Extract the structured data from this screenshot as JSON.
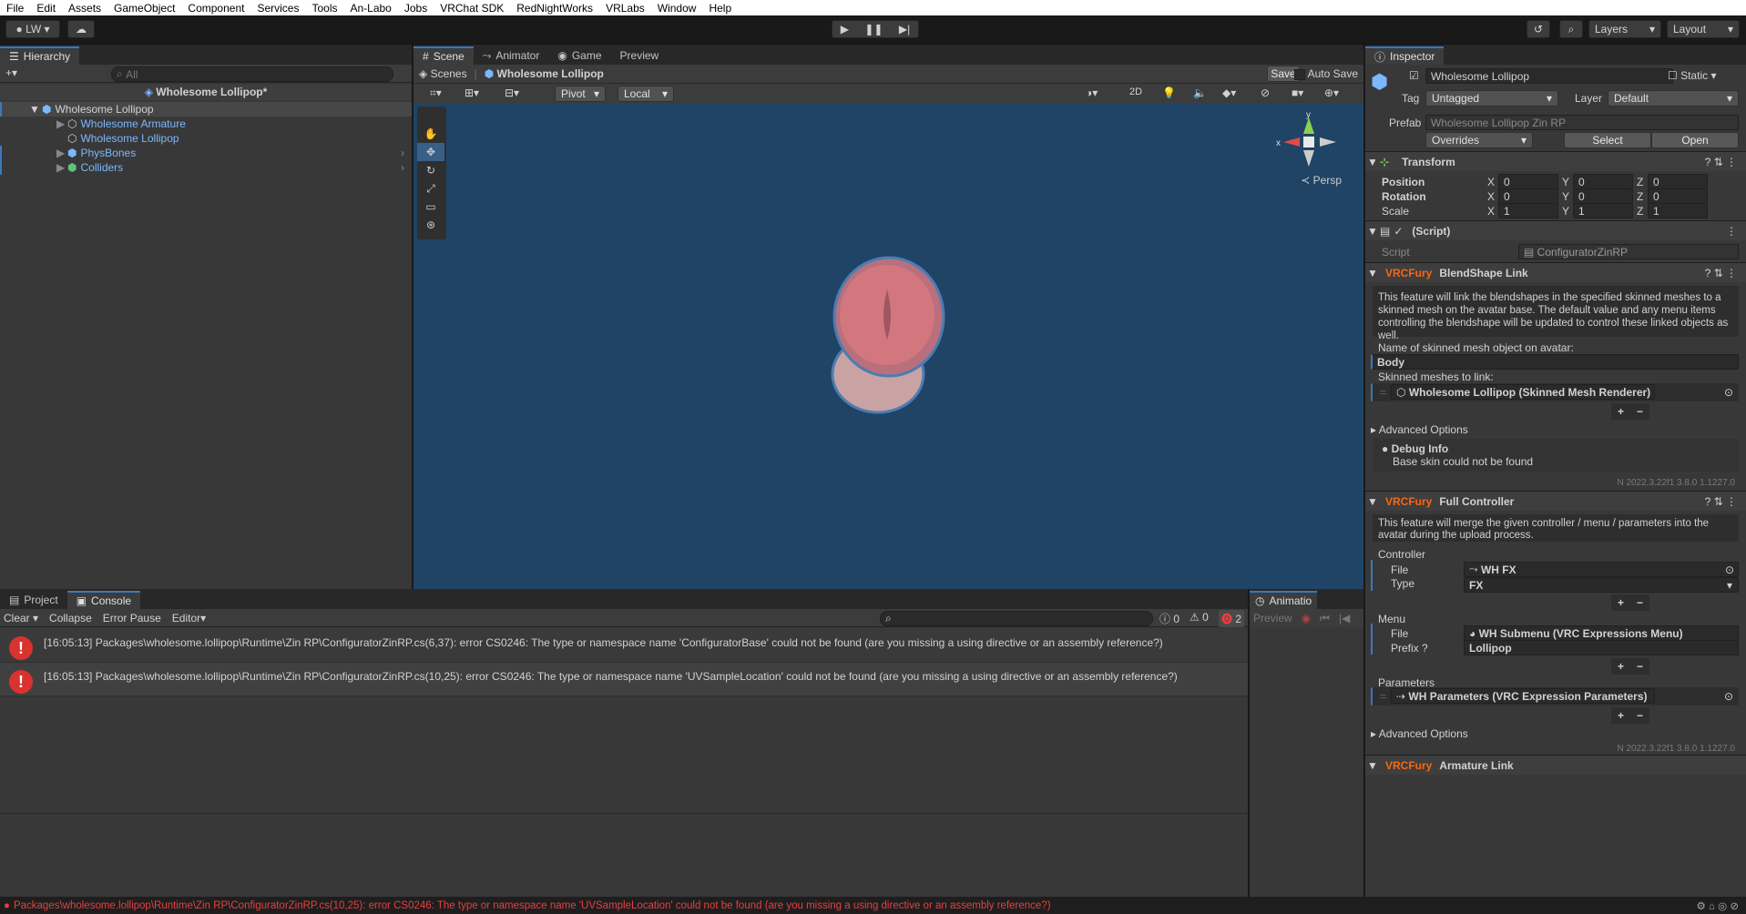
{
  "menu": [
    "File",
    "Edit",
    "Assets",
    "GameObject",
    "Component",
    "Services",
    "Tools",
    "An-Labo",
    "Jobs",
    "VRChat SDK",
    "RedNightWorks",
    "VRLabs",
    "Window",
    "Help"
  ],
  "toolbar": {
    "account": "LW",
    "layers": "Layers",
    "layout": "Layout"
  },
  "hierarchy": {
    "tab": "Hierarchy",
    "search_placeholder": "All",
    "scene": "Wholesome Lollipop*",
    "items": [
      {
        "label": "Wholesome Lollipop"
      },
      {
        "label": "Wholesome Armature"
      },
      {
        "label": "Wholesome Lollipop"
      },
      {
        "label": "PhysBones"
      },
      {
        "label": "Colliders"
      }
    ]
  },
  "scene": {
    "tabs": [
      "Scene",
      "Animator",
      "Game",
      "Preview"
    ],
    "breadcrumb": [
      "Scenes",
      "Wholesome Lollipop"
    ],
    "save": "Save",
    "autosave": "Auto Save",
    "pivot": "Pivot",
    "local": "Local",
    "mode2d": "2D",
    "persp": "Persp",
    "axis_x": "x",
    "axis_y": "y"
  },
  "console": {
    "tabs": [
      "Project",
      "Console"
    ],
    "buttons": [
      "Clear",
      "Collapse",
      "Error Pause",
      "Editor"
    ],
    "counts": {
      "log": "0",
      "warn": "0",
      "error": "2"
    },
    "entries": [
      "[16:05:13] Packages\\wholesome.lollipop\\Runtime\\Zin RP\\ConfiguratorZinRP.cs(6,37): error CS0246: The type or namespace name 'ConfiguratorBase' could not be found (are you missing a using directive or an assembly reference?)",
      "[16:05:13] Packages\\wholesome.lollipop\\Runtime\\Zin RP\\ConfiguratorZinRP.cs(10,25): error CS0246: The type or namespace name 'UVSampleLocation' could not be found (are you missing a using directive or an assembly reference?)"
    ],
    "status": "Packages\\wholesome.lollipop\\Runtime\\Zin RP\\ConfiguratorZinRP.cs(10,25): error CS0246: The type or namespace name 'UVSampleLocation' could not be found (are you missing a using directive or an assembly reference?)"
  },
  "animation": {
    "tab": "Animatio",
    "preview": "Preview"
  },
  "inspector": {
    "tab": "Inspector",
    "name": "Wholesome Lollipop",
    "static": "Static",
    "tag_label": "Tag",
    "tag": "Untagged",
    "layer_label": "Layer",
    "layer": "Default",
    "prefab_label": "Prefab",
    "prefab": "Wholesome Lollipop Zin RP",
    "overrides": "Overrides",
    "select": "Select",
    "open": "Open",
    "transform": {
      "title": "Transform",
      "position": "Position",
      "rotation": "Rotation",
      "scale": "Scale",
      "pos": [
        "0",
        "0",
        "0"
      ],
      "rot": [
        "0",
        "0",
        "0"
      ],
      "scl": [
        "1",
        "1",
        "1"
      ],
      "axes": [
        "X",
        "Y",
        "Z"
      ]
    },
    "script": {
      "title": "(Script)",
      "label": "Script",
      "value": "ConfiguratorZinRP"
    },
    "vrcfury": "VRCFury",
    "blend": {
      "title": "BlendShape Link",
      "desc": "This feature will link the blendshapes in the specified skinned meshes to a skinned mesh on the avatar base. The default value and any menu items controlling the blendshape will be updated to control these linked objects as well.",
      "name_label": "Name of skinned mesh object on avatar:",
      "name_value": "Body",
      "meshes_label": "Skinned meshes to link:",
      "mesh": "Wholesome Lollipop (Skinned Mesh Renderer)",
      "advanced": "Advanced Options",
      "debug_title": "Debug Info",
      "debug_text": "Base skin could not be found",
      "version": "N 2022.3.22f1 3.8.0 1.1227.0"
    },
    "full": {
      "title": "Full Controller",
      "desc": "This feature will merge the given controller / menu / parameters into the avatar during the upload process.",
      "controller": "Controller",
      "file": "File",
      "fx": "WH FX",
      "type_label": "Type",
      "type": "FX",
      "menu": "Menu",
      "menu_file": "WH Submenu (VRC Expressions Menu)",
      "prefix_label": "Prefix",
      "prefix": "Lollipop",
      "params": "Parameters",
      "params_file": "WH Parameters (VRC Expression Parameters)",
      "advanced": "Advanced Options",
      "version": "N 2022.3.22f1 3.8.0 1.1227.0",
      "next": "Armature Link"
    }
  },
  "colors": {
    "accent": "#3a79bb",
    "error": "#d8332f",
    "vrcfury": "#f56716",
    "scene": "#1f4466"
  }
}
